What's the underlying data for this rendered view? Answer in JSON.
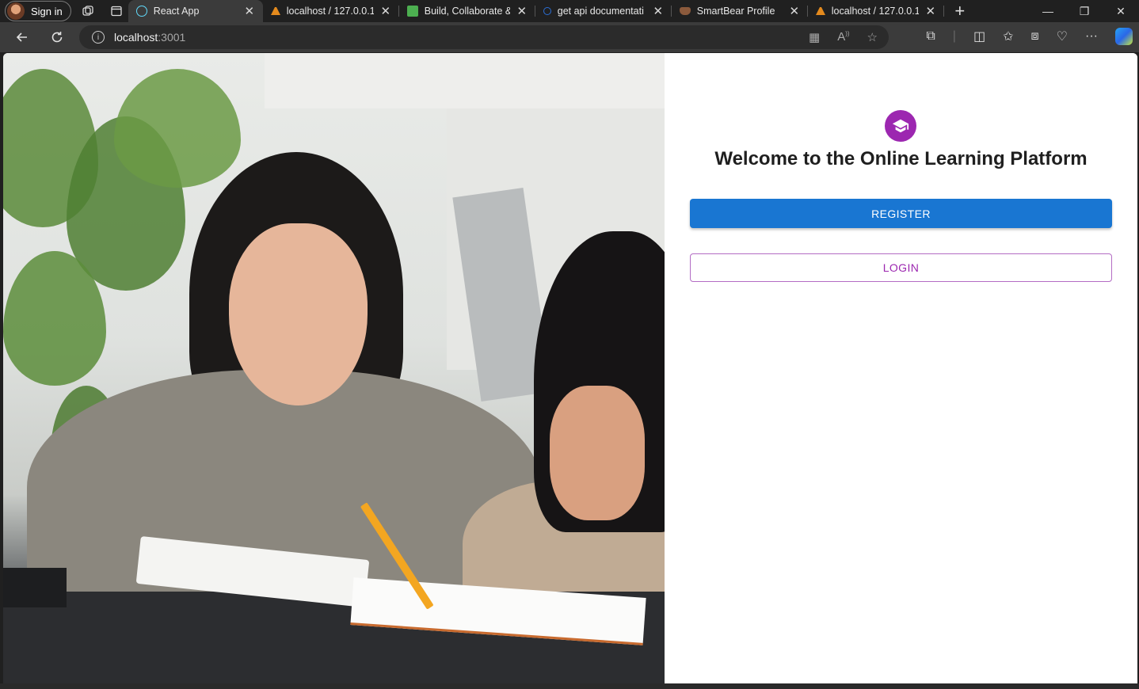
{
  "browser": {
    "profile_label": "Sign in",
    "tabs": [
      {
        "title": "React App",
        "icon": "react-icon",
        "active": true
      },
      {
        "title": "localhost / 127.0.0.1",
        "icon": "phpmyadmin-icon",
        "active": false
      },
      {
        "title": "Build, Collaborate &",
        "icon": "build-icon",
        "active": false
      },
      {
        "title": "get api documentati",
        "icon": "search-icon",
        "active": false
      },
      {
        "title": "SmartBear Profile",
        "icon": "smartbear-icon",
        "active": false
      },
      {
        "title": "localhost / 127.0.0.1",
        "icon": "phpmyadmin-icon",
        "active": false
      }
    ],
    "address": {
      "host": "localhost",
      "port": ":3001"
    }
  },
  "page": {
    "welcome_title": "Welcome to the Online Learning Platform",
    "register_label": "REGISTER",
    "login_label": "LOGIN",
    "colors": {
      "logo": "#9c27b0",
      "register_bg": "#1976d2",
      "login_text": "#9c27b0"
    }
  }
}
